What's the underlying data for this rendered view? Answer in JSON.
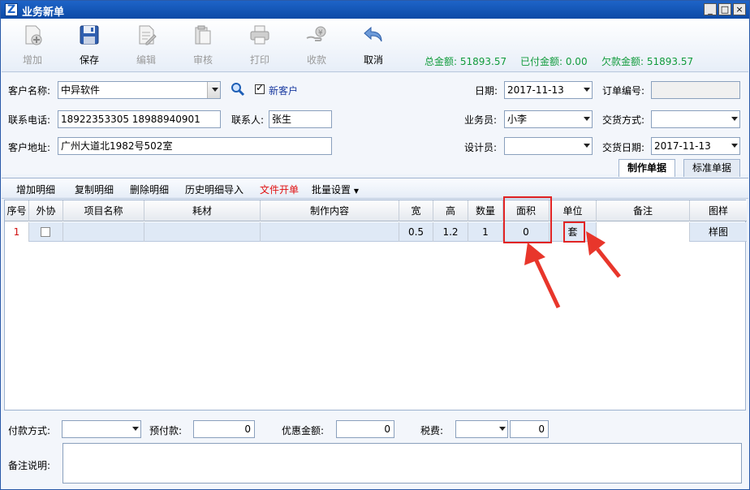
{
  "window": {
    "title": "业务新单"
  },
  "toolbar": {
    "add": "增加",
    "save": "保存",
    "edit": "编辑",
    "audit": "审核",
    "print": "打印",
    "collect": "收款",
    "cancel": "取消"
  },
  "summary": {
    "total": "总金额: 51893.57",
    "paid": "已付金额: 0.00",
    "owed": "欠款金额: 51893.57"
  },
  "form": {
    "customer_label": "客户名称:",
    "customer_value": "中异软件",
    "new_customer_label": "新客户",
    "phone_label": "联系电话:",
    "phone_value": "18922353305 18988940901",
    "contact_label": "联系人:",
    "contact_value": "张生",
    "address_label": "客户地址:",
    "address_value": "广州大道北1982号502室",
    "date_label": "日期:",
    "date_value": "2017-11-13",
    "order_no_label": "订单编号:",
    "order_no_value": "",
    "salesman_label": "业务员:",
    "salesman_value": "小李",
    "delivery_method_label": "交货方式:",
    "delivery_method_value": "",
    "designer_label": "设计员:",
    "designer_value": "",
    "delivery_date_label": "交货日期:",
    "delivery_date_value": "2017-11-13"
  },
  "tabs": {
    "make": "制作单据",
    "standard": "标准单据"
  },
  "subtoolbar": {
    "add_detail": "增加明细",
    "copy_detail": "复制明细",
    "delete_detail": "删除明细",
    "history_import": "历史明细导入",
    "file_order": "文件开单",
    "batch_settings": "批量设置"
  },
  "grid": {
    "columns": [
      "序号",
      "外协",
      "项目名称",
      "耗材",
      "制作内容",
      "宽",
      "高",
      "数量",
      "面积",
      "单位",
      "备注",
      "图样"
    ],
    "rows": [
      {
        "index": "1",
        "width": "0.5",
        "height": "1.2",
        "qty": "1",
        "area": "0",
        "unit": "套",
        "note": "",
        "sample": "样图"
      }
    ]
  },
  "bottom": {
    "payment_method_label": "付款方式:",
    "payment_method_value": "",
    "prepaid_label": "预付款:",
    "prepaid_value": "0",
    "discount_label": "优惠金额:",
    "discount_value": "0",
    "tax_label": "税费:",
    "tax_rate_value": "",
    "tax_value": "0",
    "remark_label": "备注说明:",
    "remark_value": ""
  },
  "colors": {
    "accent": "#1e64c8",
    "summary_green": "#119b3c",
    "highlight_red": "#e22424",
    "file_order_red": "#e01010"
  }
}
